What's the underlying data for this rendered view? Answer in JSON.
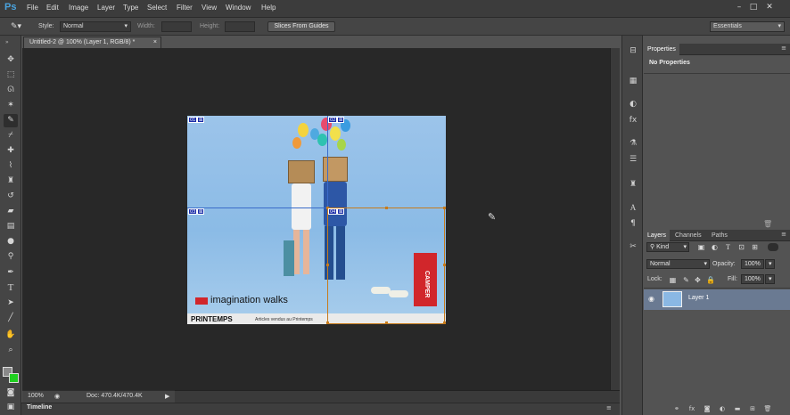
{
  "app": {
    "logo": "Ps"
  },
  "menu": [
    "File",
    "Edit",
    "Image",
    "Layer",
    "Type",
    "Select",
    "Filter",
    "View",
    "Window",
    "Help"
  ],
  "window_controls": [
    "–",
    "□",
    "✕"
  ],
  "options": {
    "style_label": "Style:",
    "style_value": "Normal",
    "width_label": "Width:",
    "height_label": "Height:",
    "slices_button": "Slices From Guides",
    "workspace": "Essentials"
  },
  "document": {
    "tab_title": "Untitled-2 @ 100% (Layer 1, RGB/8) *",
    "close": "×",
    "zoom": "100%",
    "doc_info": "Doc: 470.4K/470.4K",
    "timeline": "Timeline"
  },
  "image": {
    "slices": [
      "01",
      "02",
      "03",
      "04"
    ],
    "logo_text": "imagination walks",
    "store_text": "PRINTEMPS",
    "caption": "Articles vendus au Printemps",
    "box_text": "CAMPER"
  },
  "properties": {
    "tab": "Properties",
    "message": "No Properties"
  },
  "layers": {
    "tabs": [
      "Layers",
      "Channels",
      "Paths"
    ],
    "kind": "Kind",
    "blend_mode": "Normal",
    "opacity_label": "Opacity:",
    "opacity_value": "100%",
    "lock_label": "Lock:",
    "fill_label": "Fill:",
    "fill_value": "100%",
    "items": [
      {
        "name": "Layer 1"
      }
    ]
  }
}
